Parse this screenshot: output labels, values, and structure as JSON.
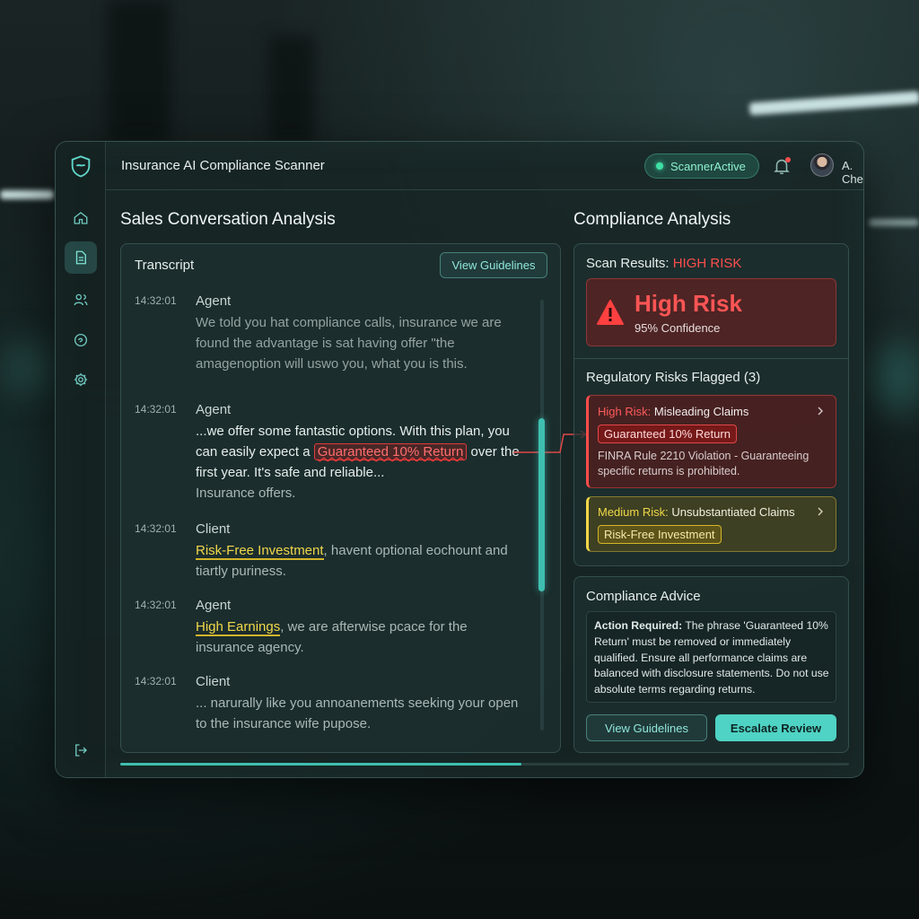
{
  "app": {
    "title": "Insurance AI Compliance Scanner",
    "status": "ScannerActive",
    "user": "A. Chen"
  },
  "colors": {
    "accent": "#4fd3c4",
    "high_risk": "#ff4d4d",
    "medium_risk": "#f1d74a",
    "status_ok": "#3fe0a5"
  },
  "sidebar": {
    "items": [
      {
        "name": "home-icon",
        "active": false
      },
      {
        "name": "document-icon",
        "active": true
      },
      {
        "name": "users-icon",
        "active": false
      },
      {
        "name": "chat-icon",
        "active": false
      },
      {
        "name": "gear-icon",
        "active": false
      },
      {
        "name": "logout-icon",
        "active": false
      }
    ]
  },
  "left": {
    "heading": "Sales Conversation Analysis",
    "transcript_title": "Transcript",
    "guidelines_button": "View Guidelines",
    "messages": [
      {
        "time": "14:32:01",
        "speaker": "Agent",
        "text": "We told you hat compliance calls, insurance we are found the advantage is sat having offer \"the amagenoption will uswo you, what you is this."
      },
      {
        "time": "14:32:01",
        "speaker": "Agent",
        "pre": "...we offer some fantastic options. With this plan, you can easily expect a ",
        "flag": "Guaranteed 10% Return",
        "post": " over the first year. It's safe and reliable...",
        "tail": "Insurance offers."
      },
      {
        "time": "14:32:01",
        "speaker": "Client",
        "flag": "Risk-Free Investment",
        "post": ", havent optional eochount and tiartly puriness."
      },
      {
        "time": "14:32:01",
        "speaker": "Agent",
        "flag": "High Earnings",
        "post": ", we are afterwise pcace for the insurance agency."
      },
      {
        "time": "14:32:01",
        "speaker": "Client",
        "text": "... narurally like you annoanements seeking your open to the insurance wife pupose."
      }
    ]
  },
  "right": {
    "heading": "Compliance Analysis",
    "scan_label": "Scan Results: ",
    "scan_value": "HIGH RISK",
    "risk_title": "High Risk",
    "confidence": "95% Confidence",
    "flagged_title": "Regulatory Risks Flagged (3)",
    "risks": [
      {
        "level": "High Risk:",
        "name": " Misleading Claims",
        "tag": "Guaranteed 10% Return",
        "desc": "FINRA Rule 2210 Violation - Guaranteeing specific returns is prohibited."
      },
      {
        "level": "Medium Risk:",
        "name": " Unsubstantiated Claims",
        "tag": "Risk-Free Investment"
      }
    ],
    "advice_title": "Compliance Advice",
    "advice_lead": "Action Required:",
    "advice_text": " The phrase 'Guaranteed 10% Return' must be removed or immediately qualified. Ensure all performance claims are balanced with disclosure statements. Do not use absolute terms regarding returns.",
    "btn_guidelines": "View Guidelines",
    "btn_escalate": "Escalate Review"
  },
  "scan_progress": 0.55
}
